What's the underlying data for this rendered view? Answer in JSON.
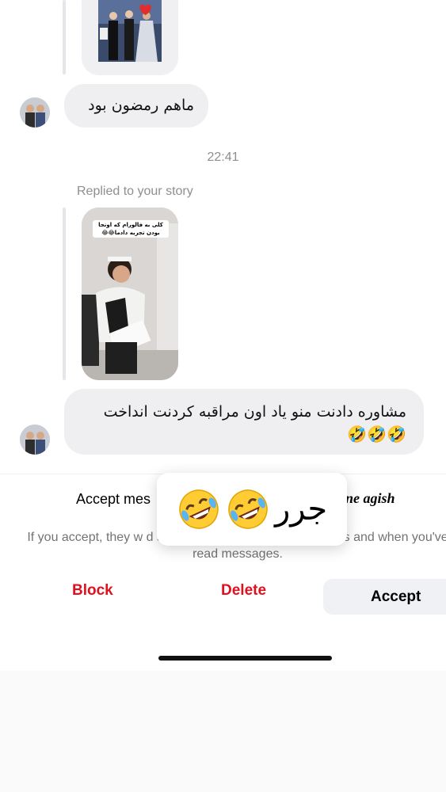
{
  "chat": {
    "message_1": "ماهم رمضون بود",
    "timestamp": "22:41",
    "reply_label": "Replied to your story",
    "story_caption": "کلی به فالورام که اونجا بودن تجربه دادما😂😂",
    "message_2": "مشاوره دادنت منو یاد اون مراقبه کردنت انداخت",
    "message_2_emojis": "🤣🤣🤣"
  },
  "request_sheet": {
    "title": "Accept mes",
    "sender_name": "ne agish",
    "info_text": "If you accept, they w                                      d see info such a your activity status and when you've read messages.",
    "block_label": "Block",
    "delete_label": "Delete",
    "accept_label": "Accept"
  },
  "reaction_popup": {
    "text": "جرر"
  },
  "colors": {
    "bubble": "#efeff2",
    "destructive": "#e0101e",
    "meta_text": "#8e8e93"
  }
}
